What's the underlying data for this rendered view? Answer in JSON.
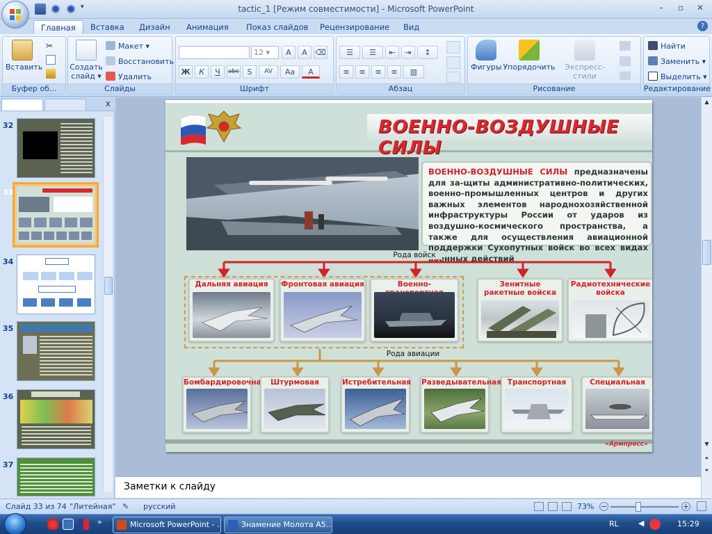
{
  "window": {
    "title": "tactic_1 [Режим совместимости] - Microsoft PowerPoint",
    "controls": [
      "–",
      "▫",
      "✕"
    ]
  },
  "ribbon_tabs": [
    "Главная",
    "Вставка",
    "Дизайн",
    "Анимация",
    "Показ слайдов",
    "Рецензирование",
    "Вид"
  ],
  "ribbon": {
    "clipboard": {
      "paste": "Вставить",
      "label": "Буфер об..."
    },
    "slides": {
      "create": "Создать слайд",
      "create_l1": "Создать",
      "create_l2": "слайд",
      "layout": "Макет",
      "reset": "Восстановить",
      "delete": "Удалить",
      "label": "Слайды"
    },
    "font": {
      "font_size": "12",
      "label": "Шрифт",
      "buttons": [
        "Ж",
        "К",
        "Ч",
        "abc",
        "S",
        "AV",
        "Aa",
        "A"
      ]
    },
    "paragraph": {
      "label": "Абзац"
    },
    "drawing": {
      "shapes": "Фигуры",
      "arrange": "Упорядочить",
      "express": "Экспресс-стили",
      "label": "Рисование"
    },
    "editing": {
      "find": "Найти",
      "replace": "Заменить",
      "select": "Выделить",
      "label": "Редактирование"
    }
  },
  "slide_panel": {
    "thumbnails": [
      {
        "num": "32"
      },
      {
        "num": "33"
      },
      {
        "num": "34"
      },
      {
        "num": "35"
      },
      {
        "num": "36"
      },
      {
        "num": "37"
      }
    ]
  },
  "slide": {
    "title": "ВОЕННО-ВОЗДУШНЫЕ СИЛЫ",
    "desc_lead": "ВОЕННО-ВОЗДУШНЫЕ СИЛЫ",
    "desc_rest": " предназначены для за-щиты административно-политических, военно-промышленных центров и других важных элементов народнохозяйственной инфраструктуры России от ударов из воздушно-космического пространства, а также для осуществления авиационной поддержки Сухопутных войск во всех видах военных действий",
    "roda_voisk": "Рода войск",
    "roda_aviacii": "Рода авиации",
    "troops": [
      "Дальняя авиация",
      "Фронтовая авиация",
      "Военно-транспортная авиация",
      "Зенитные ракетные войска",
      "Радиотехнические войска"
    ],
    "aviation": [
      "Бомбардировочная",
      "Штурмовая",
      "Истребительная",
      "Разведывательная",
      "Транспортная",
      "Специальная"
    ],
    "watermark": "«Армпресс»"
  },
  "notes": {
    "placeholder": "Заметки к слайду"
  },
  "status": {
    "slide_info": "Слайд 33 из 74",
    "theme": "\"Литейная\"",
    "language": "русский",
    "zoom": "73%",
    "zoom_level": 0.4
  },
  "taskbar": {
    "items": [
      "Microsoft PowerPoint - ...",
      "Знамение Молота А5..."
    ],
    "lang": "RL",
    "time": "15:29"
  },
  "colors": {
    "accent_red": "#d2232a",
    "ribbon_text": "#15428b",
    "selected_thumb": "#f1a93c"
  }
}
